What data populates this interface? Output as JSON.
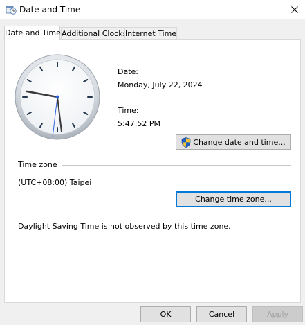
{
  "window": {
    "title": "Date and Time"
  },
  "tabs": [
    {
      "label": "Date and Time"
    },
    {
      "label": "Additional Clocks"
    },
    {
      "label": "Internet Time"
    }
  ],
  "date": {
    "label": "Date:",
    "value": "Monday, July 22, 2024"
  },
  "time": {
    "label": "Time:",
    "value": "5:47:52 PM"
  },
  "change_datetime_button": "Change date and time...",
  "timezone": {
    "heading": "Time zone",
    "value": "(UTC+08:00) Taipei",
    "change_button": "Change time zone...",
    "dst_note": "Daylight Saving Time is not observed by this time zone."
  },
  "footer": {
    "ok": "OK",
    "cancel": "Cancel",
    "apply": "Apply"
  },
  "colors": {
    "accent": "#0078d7",
    "shield_blue": "#1c5fc8",
    "shield_yellow": "#f2c230"
  },
  "icons": {
    "app": "date-time-icon",
    "close": "close-icon",
    "shield": "uac-shield-icon"
  }
}
